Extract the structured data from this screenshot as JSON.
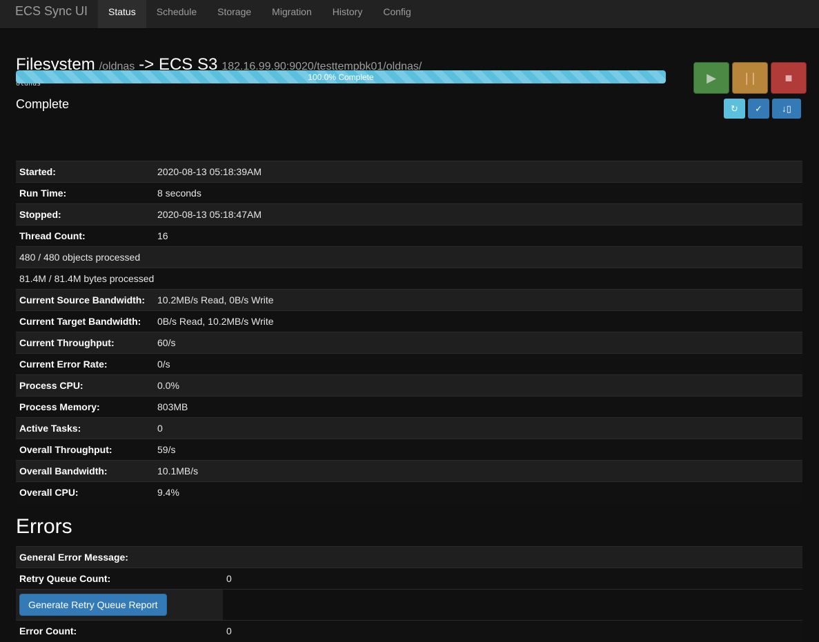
{
  "app": {
    "brand": "ECS Sync UI"
  },
  "nav": {
    "tabs": [
      {
        "label": "Status",
        "active": true
      },
      {
        "label": "Schedule"
      },
      {
        "label": "Storage"
      },
      {
        "label": "Migration"
      },
      {
        "label": "History"
      },
      {
        "label": "Config"
      }
    ]
  },
  "job": {
    "source_type": "Filesystem",
    "source_path": "/oldnas",
    "arrow_target": "-> ECS S3",
    "target_path": "182.16.99.90:9020/testtempbk01/oldnas/",
    "name": "oldnas",
    "progress_percent": 100,
    "progress_label": "100.0% Complete",
    "status": "Complete"
  },
  "controls": {
    "play_icon": "▶",
    "pause_icon": "| |",
    "stop_icon": "■",
    "refresh_icon": "↻",
    "check_icon": "✓",
    "download_icon": "↓▯"
  },
  "colors": {
    "progress": "#5bc0de",
    "play": "#4a8a44",
    "pause": "#b8863a",
    "stop": "#b13b38",
    "primary": "#337ab7"
  },
  "stats": {
    "started_label": "Started:",
    "started": "2020-08-13 05:18:39AM",
    "runtime_label": "Run Time:",
    "runtime": "8 seconds",
    "stopped_label": "Stopped:",
    "stopped": "2020-08-13 05:18:47AM",
    "threads_label": "Thread Count:",
    "threads": "16",
    "objects": "480 / 480 objects processed",
    "bytes": "81.4M / 81.4M bytes processed",
    "src_bw_label": "Current Source Bandwidth:",
    "src_bw": "10.2MB/s Read, 0B/s Write",
    "tgt_bw_label": "Current Target Bandwidth:",
    "tgt_bw": "0B/s Read, 10.2MB/s Write",
    "cur_tp_label": "Current Throughput:",
    "cur_tp": "60/s",
    "err_rate_label": "Current Error Rate:",
    "err_rate": "0/s",
    "cpu_label": "Process CPU:",
    "cpu": "0.0%",
    "mem_label": "Process Memory:",
    "mem": "803MB",
    "tasks_label": "Active Tasks:",
    "tasks": "0",
    "ov_tp_label": "Overall Throughput:",
    "ov_tp": "59/s",
    "ov_bw_label": "Overall Bandwidth:",
    "ov_bw": "10.1MB/s",
    "ov_cpu_label": "Overall CPU:",
    "ov_cpu": "9.4%"
  },
  "errors": {
    "title": "Errors",
    "general_label": "General Error Message:",
    "retry_label": "Retry Queue Count:",
    "retry_count": "0",
    "retry_button": "Generate Retry Queue Report",
    "error_count_label": "Error Count:",
    "error_count": "0"
  }
}
